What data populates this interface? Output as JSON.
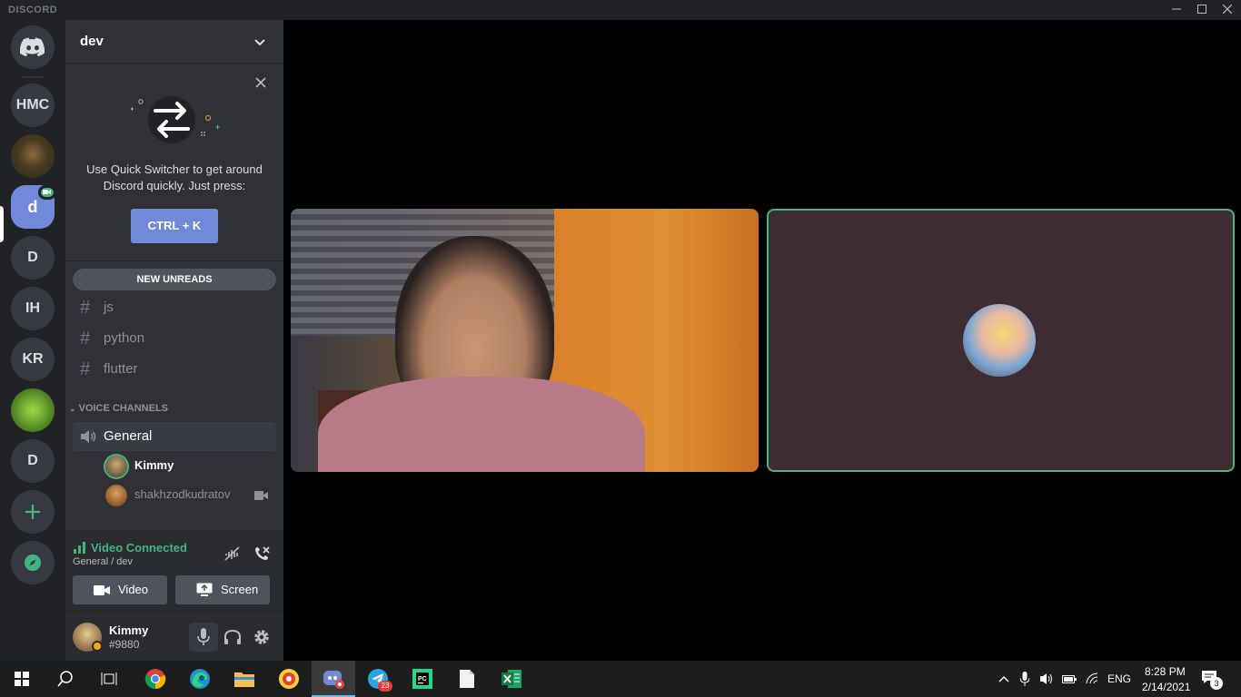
{
  "window": {
    "brand": "DISCORD",
    "controls": [
      "minimize",
      "maximize",
      "close"
    ]
  },
  "servers": [
    {
      "label": "",
      "icon": "discord-home-icon"
    },
    {
      "label": "HMC"
    },
    {
      "label": "",
      "icon": "server-image"
    },
    {
      "label": "d",
      "active": true
    },
    {
      "label": "D"
    },
    {
      "label": "IH"
    },
    {
      "label": "KR"
    },
    {
      "label": "",
      "icon": "server-image"
    },
    {
      "label": "D"
    }
  ],
  "guild": {
    "name": "dev"
  },
  "quick_switcher": {
    "text": "Use Quick Switcher to get around Discord quickly. Just press:",
    "shortcut": "CTRL + K"
  },
  "new_unreads": "NEW UNREADS",
  "text_channels": [
    "js",
    "python",
    "flutter"
  ],
  "voice_category": "VOICE CHANNELS",
  "voice_channel": {
    "name": "General",
    "users": [
      {
        "name": "Kimmy",
        "speaking": true
      },
      {
        "name": "shakhzodkudratov",
        "video": true
      }
    ]
  },
  "voice_panel": {
    "status": "Video Connected",
    "location": "General / dev",
    "video_label": "Video",
    "screen_label": "Screen"
  },
  "user": {
    "name": "Kimmy",
    "tag": "#9880"
  },
  "taskbar": {
    "language": "ENG",
    "time": "8:28 PM",
    "date": "2/14/2021",
    "telegram_badge": "23",
    "notification_count": "3"
  },
  "colors": {
    "accent": "#7289da",
    "connected": "#43b581",
    "speaking_ring": "#43b581"
  }
}
